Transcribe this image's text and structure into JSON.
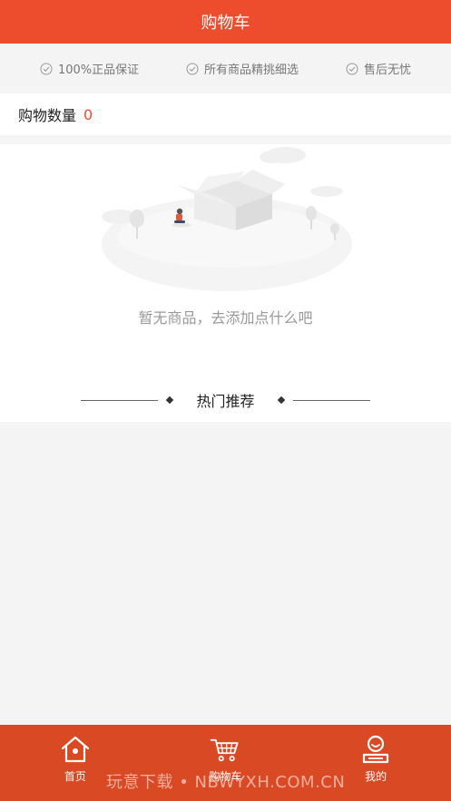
{
  "header": {
    "title": "购物车"
  },
  "guarantees": [
    {
      "icon": "check-circle-icon",
      "label": "100%正品保证"
    },
    {
      "icon": "check-circle-icon",
      "label": "所有商品精挑细选"
    },
    {
      "icon": "check-circle-icon",
      "label": "售后无忧"
    }
  ],
  "cart": {
    "count_label": "购物数量",
    "count": "0"
  },
  "empty": {
    "message": "暂无商品，去添加点什么吧"
  },
  "hot": {
    "title": "热门推荐"
  },
  "tabbar": {
    "items": [
      {
        "label": "首页",
        "icon": "home-icon"
      },
      {
        "label": "购物车",
        "icon": "cart-icon"
      },
      {
        "label": "我的",
        "icon": "user-icon"
      }
    ]
  },
  "watermark": "玩意下载 • NBWYXH.COM.CN",
  "colors": {
    "primary": "#ee4d2d",
    "tabbar": "#d94a24",
    "background": "#f4f4f4"
  }
}
